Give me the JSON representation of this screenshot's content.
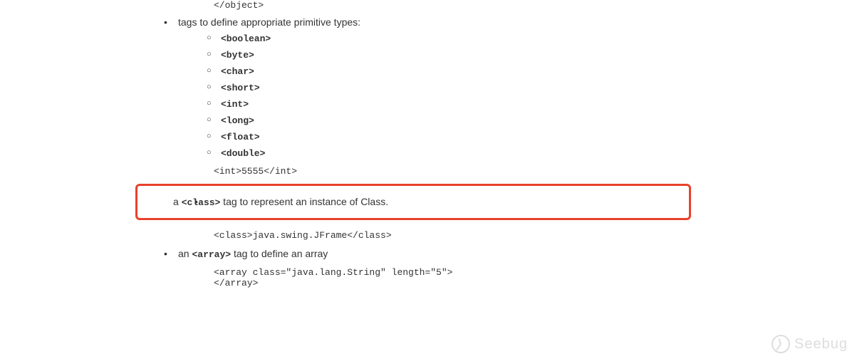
{
  "top_code": "</object>",
  "bullet1": {
    "text": "tags to define appropriate primitive types:",
    "items": [
      "<boolean>",
      "<byte>",
      "<char>",
      "<short>",
      "<int>",
      "<long>",
      "<float>",
      "<double>"
    ],
    "example": "<int>5555</int>"
  },
  "bullet2": {
    "prefix": "a ",
    "code": "<class>",
    "suffix": " tag to represent an instance of Class.",
    "example": "<class>java.swing.JFrame</class>"
  },
  "bullet3": {
    "prefix": "an ",
    "code": "<array>",
    "suffix": " tag to define an array",
    "example_line1": "<array class=\"java.lang.String\" length=\"5\">",
    "example_line2": "</array>"
  },
  "watermark": "Seebug"
}
